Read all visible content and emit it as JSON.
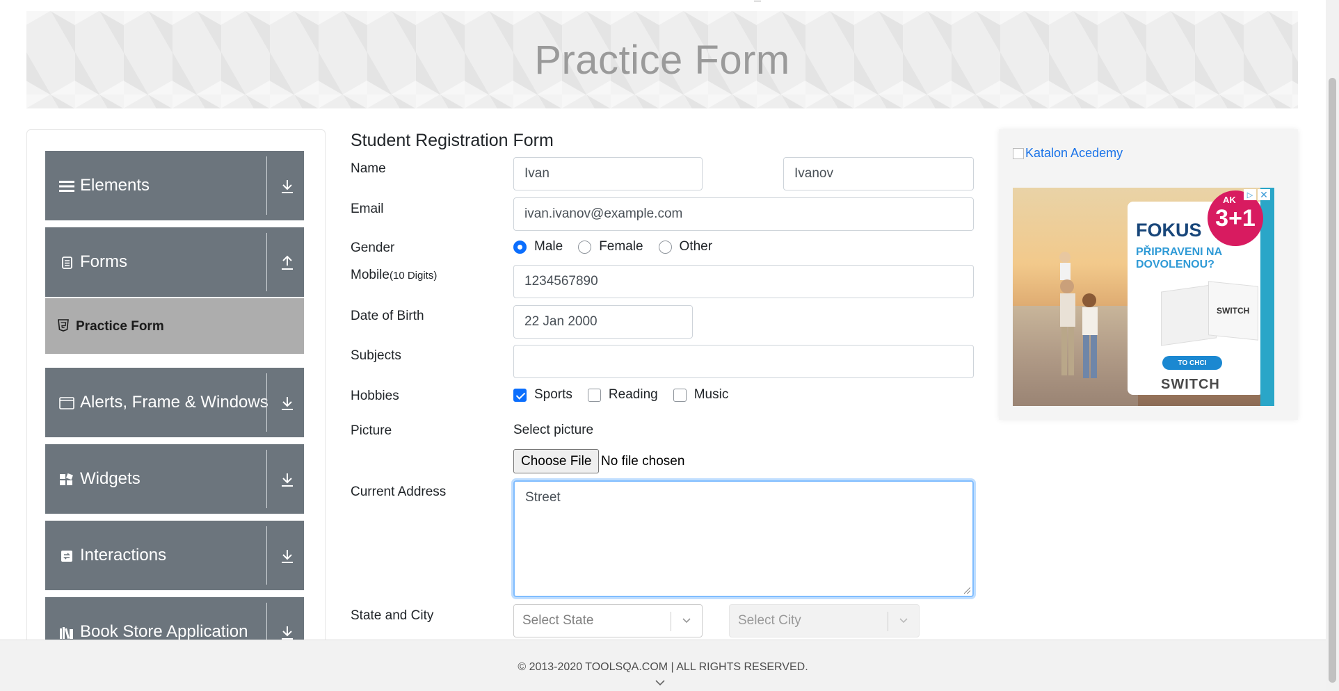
{
  "header": {
    "title": "Practice Form"
  },
  "sidebar": {
    "categories": [
      {
        "label": "Elements",
        "icon": "list-icon",
        "arrow": "download-icon"
      },
      {
        "label": "Forms",
        "icon": "document-icon",
        "arrow": "upload-icon"
      },
      {
        "label": "Alerts, Frame & Windows",
        "icon": "window-icon",
        "arrow": "download-icon"
      },
      {
        "label": "Widgets",
        "icon": "widgets-icon",
        "arrow": "download-icon"
      },
      {
        "label": "Interactions",
        "icon": "interactions-icon",
        "arrow": "download-icon"
      },
      {
        "label": "Book Store Application",
        "icon": "books-icon",
        "arrow": "download-icon"
      }
    ],
    "active_item": {
      "label": "Practice Form",
      "icon": "html5-icon"
    }
  },
  "form": {
    "title": "Student Registration Form",
    "name_label": "Name",
    "first_name": "Ivan",
    "last_name": "Ivanov",
    "email_label": "Email",
    "email": "ivan.ivanov@example.com",
    "gender_label": "Gender",
    "gender_options": [
      "Male",
      "Female",
      "Other"
    ],
    "gender_selected": "Male",
    "mobile_label": "Mobile",
    "mobile_hint": "(10 Digits)",
    "mobile": "1234567890",
    "dob_label": "Date of Birth",
    "dob": "22 Jan 2000",
    "subjects_label": "Subjects",
    "subjects": "",
    "hobbies_label": "Hobbies",
    "hobbies": [
      {
        "label": "Sports",
        "checked": true
      },
      {
        "label": "Reading",
        "checked": false
      },
      {
        "label": "Music",
        "checked": false
      }
    ],
    "picture_label": "Picture",
    "picture_hint": "Select picture",
    "file_button": "Choose File",
    "file_status": "No file chosen",
    "address_label": "Current Address",
    "address": "Street",
    "state_city_label": "State and City",
    "state_placeholder": "Select State",
    "city_placeholder": "Select City"
  },
  "ad": {
    "link_text": "Katalon Acedemy",
    "brand": "FOKUS",
    "promo": "PŘIPRAVENI NA DOVOLENOU?",
    "badge_top": "AK",
    "badge": "3+1",
    "box_label": "SWITCH",
    "cta": "TO CHCI",
    "product": "SWITCH"
  },
  "footer": {
    "text": "© 2013-2020 TOOLSQA.COM | ALL RIGHTS RESERVED."
  },
  "colors": {
    "accent": "#0b6efd",
    "sidebar_bg": "#6c757d",
    "active_item_bg": "#adadad",
    "focus_border": "#80bdff"
  }
}
